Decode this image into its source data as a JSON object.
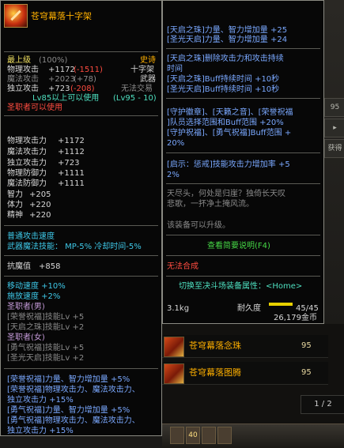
{
  "left_tip": {
    "title": "苍穹幕落十字架",
    "min_level_label": "最上级",
    "min_level_pct": "(100%)",
    "rarity": "史诗",
    "phys_atk_label": "物理攻击",
    "phys_atk_val": "+1172",
    "phys_atk_diff": "(-1511)",
    "type": "十字架",
    "mag_atk_label": "魔法攻击",
    "mag_atk_val": "+2023",
    "mag_atk_diff": "(+78)",
    "category": "武器",
    "ind_atk_label": "独立攻击",
    "ind_atk_val": "+723",
    "ind_atk_diff": "(-208)",
    "trade": "无法交易",
    "level_req": "Lv85以上可以使用",
    "level_range": "(Lv95 - 10)",
    "class_req": "圣职者可以使用",
    "stats": [
      {
        "label": "物理攻击力",
        "value": "+1172"
      },
      {
        "label": "魔法攻击力",
        "value": "+1112"
      },
      {
        "label": "独立攻击力",
        "value": "+723"
      },
      {
        "label": "物理防御力",
        "value": "+1111"
      },
      {
        "label": "魔法防御力",
        "value": "+1111"
      },
      {
        "label": "智力",
        "value": "+205"
      },
      {
        "label": "体力",
        "value": "+220"
      },
      {
        "label": "精神",
        "value": "+220"
      }
    ],
    "atk_speed_type": "普通攻击速度",
    "weapon_skill": "武器魔法技能： MP-5% 冷却时间-5%",
    "resist_label": "抗魔值",
    "resist_val": "+858",
    "move_speed": "移动速度 +10%",
    "cast_speed": "施放速度 +2%",
    "male_class": "圣职者(男)",
    "male_skill_1": "[荣誉祝福]技能Lv +5",
    "male_skill_2": "[天启之珠]技能Lv +2",
    "female_class": "圣职者(女)",
    "female_skill_1": "[勇气祝福]技能Lv +5",
    "female_skill_2": "[圣光天启]技能Lv +2",
    "buff_lines": [
      "[荣誉祝福]力量、智力增加量 +5%",
      "[荣誉祝福]物理攻击力、魔法攻击力、",
      "独立攻击力 +15%",
      "[勇气祝福]力量、智力增加量 +5%",
      "[勇气祝福]物理攻击力、魔法攻击力、",
      "独立攻击力 +15%"
    ]
  },
  "right_tip": {
    "lines_a": [
      "[天启之珠]力量、智力增加量 +25",
      "[圣光天启]力量、智力增加量 +24"
    ],
    "lines_b": [
      "[天启之珠]删除攻击力和攻击持续",
      "时间",
      "[天启之珠]Buff持续时间 +10秒",
      "[圣光天启]Buff持续时间 +10秒"
    ],
    "lines_c": [
      "[守护徽章]、[天籁之音]、[荣誉祝福",
      "]队员选择范围和Buff范围 +20%",
      "[守护祝福]、[勇气祝福]Buff范围 +",
      "20%"
    ],
    "lines_d": [
      "[启示：惩戒]技能攻击力增加率 +5",
      "2%"
    ],
    "flavor": [
      "天尽头，何处是归崖？独倚长天叹",
      "悲歌，一抔净土掩风流。"
    ],
    "upgradable": "该装备可以升级。",
    "view_desc": "查看简要说明(F4)",
    "no_synth": "无法合成",
    "switch_duel": "切换至决斗场装备属性：<Home>",
    "weight": "3.1kg",
    "durability_label": "耐久度",
    "durability_val": "45/45",
    "price": "26,179金币"
  },
  "items": [
    {
      "name": "苍穹幕落念珠",
      "level": "95"
    },
    {
      "name": "苍穹幕落图腾",
      "level": "95"
    }
  ],
  "side": {
    "num": "95",
    "get": "获得",
    "pager": "1 / 2",
    "slot_label": "40"
  },
  "colors": {
    "epic": "#ffb000",
    "bonus_blue": "#7aa8ff",
    "negative": "#ff4c40",
    "green_link": "#46d846"
  }
}
